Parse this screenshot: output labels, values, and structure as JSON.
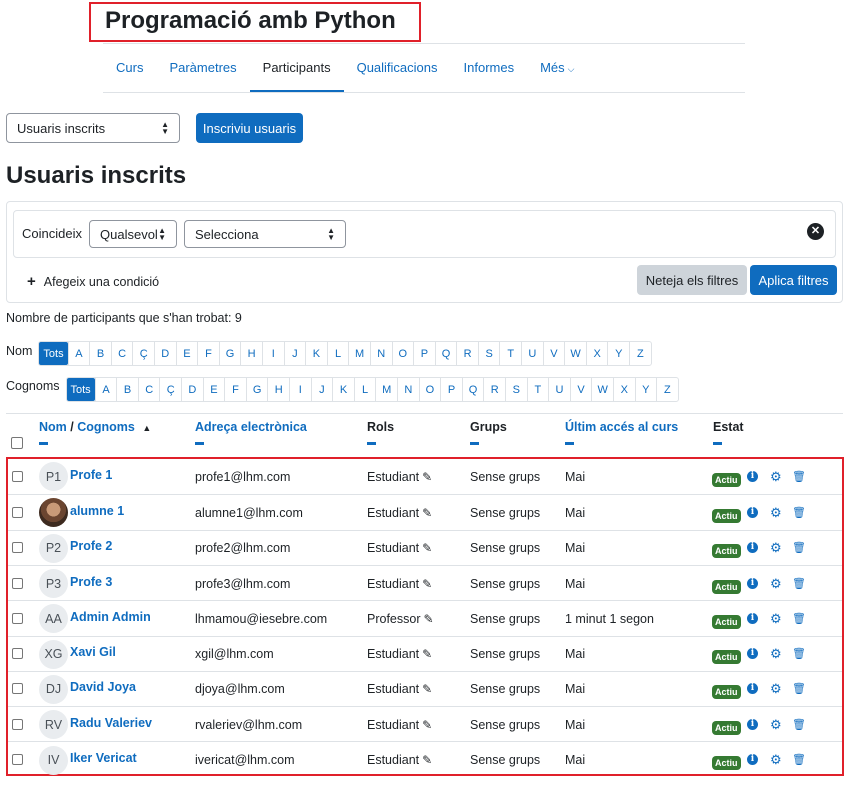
{
  "course": {
    "title": "Programació amb Python"
  },
  "nav": {
    "tabs": [
      {
        "label": "Curs"
      },
      {
        "label": "Paràmetres"
      },
      {
        "label": "Participants"
      },
      {
        "label": "Qualificacions"
      },
      {
        "label": "Informes"
      },
      {
        "label": "Més"
      }
    ]
  },
  "page_select": {
    "value": "Usuaris inscrits"
  },
  "enrol_button": {
    "label": "Inscriviu usuaris"
  },
  "heading": "Usuaris inscrits",
  "filter": {
    "match_label": "Coincideix",
    "match_value": "Qualsevol",
    "type_value": "Selecciona",
    "add_condition": "Afegeix una condició",
    "clear_label": "Neteja els filtres",
    "apply_label": "Aplica filtres"
  },
  "count_text": "Nombre de participants que s'han trobat: 9",
  "initials": {
    "first_label": "Nom",
    "last_label": "Cognoms",
    "all": "Tots",
    "letters": [
      "A",
      "B",
      "C",
      "Ç",
      "D",
      "E",
      "F",
      "G",
      "H",
      "I",
      "J",
      "K",
      "L",
      "M",
      "N",
      "O",
      "P",
      "Q",
      "R",
      "S",
      "T",
      "U",
      "V",
      "W",
      "X",
      "Y",
      "Z"
    ]
  },
  "table": {
    "headers": {
      "name_first": "Nom",
      "name_sep": " / ",
      "name_last": "Cognoms",
      "email": "Adreça electrònica",
      "roles": "Rols",
      "groups": "Grups",
      "last_access": "Últim accés al curs",
      "status": "Estat"
    },
    "rows": [
      {
        "initials": "P1",
        "name": "Profe 1",
        "email": "profe1@lhm.com",
        "role": "Estudiant",
        "groups": "Sense grups",
        "last": "Mai",
        "status": "Actiu"
      },
      {
        "initials": "",
        "name": "alumne 1",
        "email": "alumne1@lhm.com",
        "role": "Estudiant",
        "groups": "Sense grups",
        "last": "Mai",
        "status": "Actiu"
      },
      {
        "initials": "P2",
        "name": "Profe 2",
        "email": "profe2@lhm.com",
        "role": "Estudiant",
        "groups": "Sense grups",
        "last": "Mai",
        "status": "Actiu"
      },
      {
        "initials": "P3",
        "name": "Profe 3",
        "email": "profe3@lhm.com",
        "role": "Estudiant",
        "groups": "Sense grups",
        "last": "Mai",
        "status": "Actiu"
      },
      {
        "initials": "AA",
        "name": "Admin Admin",
        "email": "lhmamou@iesebre.com",
        "role": "Professor",
        "groups": "Sense grups",
        "last": "1 minut 1 segon",
        "status": "Actiu"
      },
      {
        "initials": "XG",
        "name": "Xavi Gil",
        "email": "xgil@lhm.com",
        "role": "Estudiant",
        "groups": "Sense grups",
        "last": "Mai",
        "status": "Actiu"
      },
      {
        "initials": "DJ",
        "name": "David Joya",
        "email": "djoya@lhm.com",
        "role": "Estudiant",
        "groups": "Sense grups",
        "last": "Mai",
        "status": "Actiu"
      },
      {
        "initials": "RV",
        "name": "Radu Valeriev",
        "email": "rvaleriev@lhm.com",
        "role": "Estudiant",
        "groups": "Sense grups",
        "last": "Mai",
        "status": "Actiu"
      },
      {
        "initials": "IV",
        "name": "Iker Vericat",
        "email": "ivericat@lhm.com",
        "role": "Estudiant",
        "groups": "Sense grups",
        "last": "Mai",
        "status": "Actiu"
      }
    ]
  },
  "colors": {
    "link": "#0f6cbf",
    "active_badge": "#357a32",
    "highlight_border": "#e0202a"
  }
}
